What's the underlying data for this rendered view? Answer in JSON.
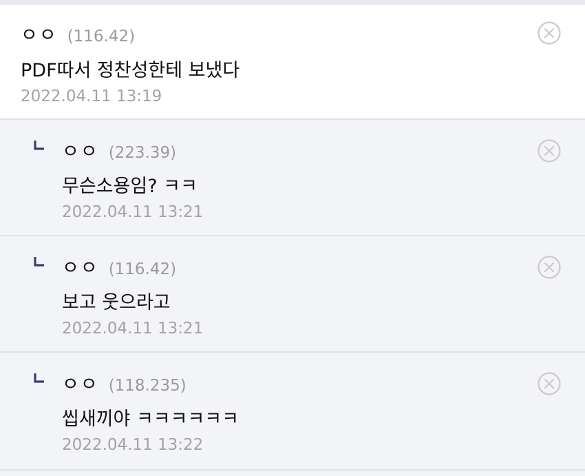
{
  "icons": {
    "delete": "close-circle-icon",
    "reply": "reply-arrow-icon"
  },
  "colors": {
    "reply_marker": "#3b3f73",
    "delete_icon": "#c9c9cf",
    "date": "#a3a3a3"
  },
  "comments": [
    {
      "nick": "ㅇㅇ",
      "ip": "(116.42)",
      "text": "PDF따서 정찬성한테 보냈다",
      "date": "2022.04.11 13:19"
    },
    {
      "nick": "ㅇㅇ",
      "ip": "(223.39)",
      "text": "무슨소용임? ㅋㅋ",
      "date": "2022.04.11 13:21"
    },
    {
      "nick": "ㅇㅇ",
      "ip": "(116.42)",
      "text": "보고 웃으라고",
      "date": "2022.04.11 13:21"
    },
    {
      "nick": "ㅇㅇ",
      "ip": "(118.235)",
      "text": "씹새끼야 ㅋㅋㅋㅋㅋㅋ",
      "date": "2022.04.11 13:22"
    }
  ]
}
